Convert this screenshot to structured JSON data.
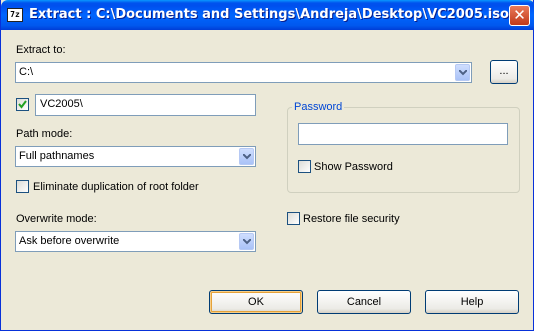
{
  "window": {
    "title": "Extract : C:\\Documents and Settings\\Andreja\\Desktop\\VC2005.iso",
    "app_icon": "7z",
    "close_glyph": "✕"
  },
  "extract_to": {
    "label": "Extract to:",
    "value": "C:\\",
    "browse_label": "..."
  },
  "subfolder": {
    "checked": true,
    "value": "VC2005\\"
  },
  "path_mode": {
    "label": "Path mode:",
    "value": "Full pathnames"
  },
  "eliminate_duplication": {
    "label": "Eliminate duplication of root folder",
    "checked": false
  },
  "overwrite_mode": {
    "label": "Overwrite mode:",
    "value": "Ask before overwrite"
  },
  "password": {
    "group_label": "Password",
    "value": "",
    "show_label": "Show Password",
    "show_checked": false
  },
  "restore_security": {
    "label": "Restore file security",
    "checked": false
  },
  "buttons": {
    "ok": "OK",
    "cancel": "Cancel",
    "help": "Help"
  }
}
